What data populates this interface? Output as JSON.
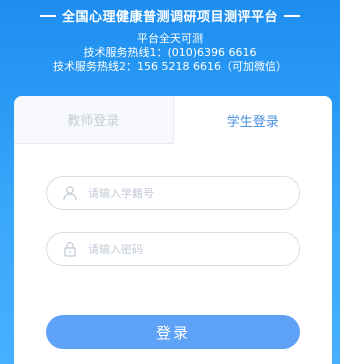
{
  "header": {
    "title": "全国心理健康普测调研项目测评平台",
    "line1": "平台全天可测",
    "line2": "技术服务热线1：(010)6396 6616",
    "line3": "技术服务热线2：156 5218 6616（可加微信）"
  },
  "tabs": {
    "teacher_label": "教师登录",
    "student_label": "学生登录",
    "active": "student"
  },
  "form": {
    "student_id_placeholder": "请输入学籍号",
    "student_id_value": "",
    "password_placeholder": "请输入密码",
    "password_value": ""
  },
  "login_button": {
    "label": "登录"
  },
  "colors": {
    "background": "#2a9bf5",
    "active_tab_text": "#4a8fe0",
    "inactive_tab_text": "#c7cfda",
    "button_bg": "#5ea2f7",
    "icon_color": "#c2cad6"
  },
  "icons": {
    "user_field": "user-icon",
    "password_field": "lock-icon"
  }
}
